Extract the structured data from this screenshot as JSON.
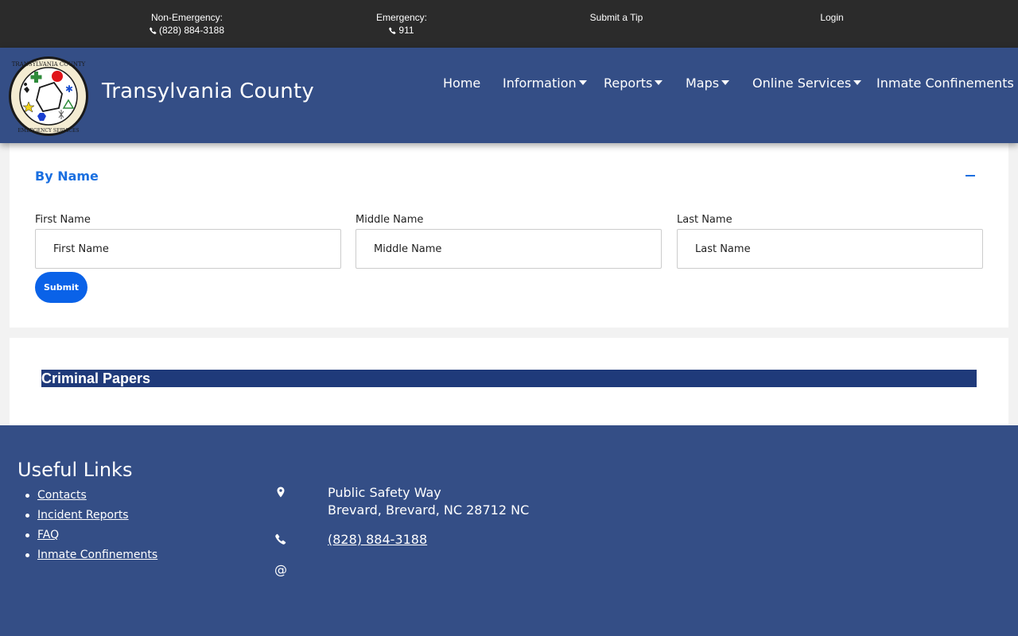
{
  "topbar": {
    "non_emergency_label": "Non-Emergency:",
    "non_emergency_phone": "(828) 884-3188",
    "emergency_label": "Emergency:",
    "emergency_phone": "911",
    "tip_label": "Submit a Tip",
    "login_label": "Login"
  },
  "header": {
    "title": "Transylvania County",
    "logo_text_top": "TRANSYLVANIA COUNTY",
    "logo_text_bottom": "EMERGENCY SERVICES",
    "nav": [
      {
        "label": "Home",
        "has_dropdown": false
      },
      {
        "label": "Information",
        "has_dropdown": true
      },
      {
        "label": "Reports",
        "has_dropdown": true
      },
      {
        "label": "Maps",
        "has_dropdown": true
      },
      {
        "label": "Online Services",
        "has_dropdown": true
      },
      {
        "label": "Inmate Confinements",
        "has_dropdown": false
      }
    ]
  },
  "search_by_name": {
    "title": "By Name",
    "fields": [
      {
        "label": "First Name",
        "placeholder": "First Name",
        "value": ""
      },
      {
        "label": "Middle Name",
        "placeholder": "Middle Name",
        "value": ""
      },
      {
        "label": "Last Name",
        "placeholder": "Last Name",
        "value": ""
      }
    ],
    "submit_label": "Submit"
  },
  "criminal_papers": {
    "title": "Criminal Papers"
  },
  "footer": {
    "links_title": "Useful Links",
    "links": [
      "Contacts",
      "Incident Reports",
      "FAQ",
      "Inmate Confinements"
    ],
    "address_line1": "Public Safety Way",
    "address_line2": "Brevard, Brevard, NC 28712 NC",
    "phone": "(828) 884-3188",
    "email_icon": "@"
  },
  "colors": {
    "topbar_bg": "#2b2b2b",
    "header_bg": "#344e86",
    "accent_blue": "#1a6fe0",
    "submit_bg": "#0a62e8",
    "papers_bar_bg": "#1f3a7a"
  },
  "icons": [
    "phone-icon",
    "caret-down-icon",
    "minus-icon",
    "map-marker-icon",
    "at-icon",
    "county-seal-logo"
  ]
}
